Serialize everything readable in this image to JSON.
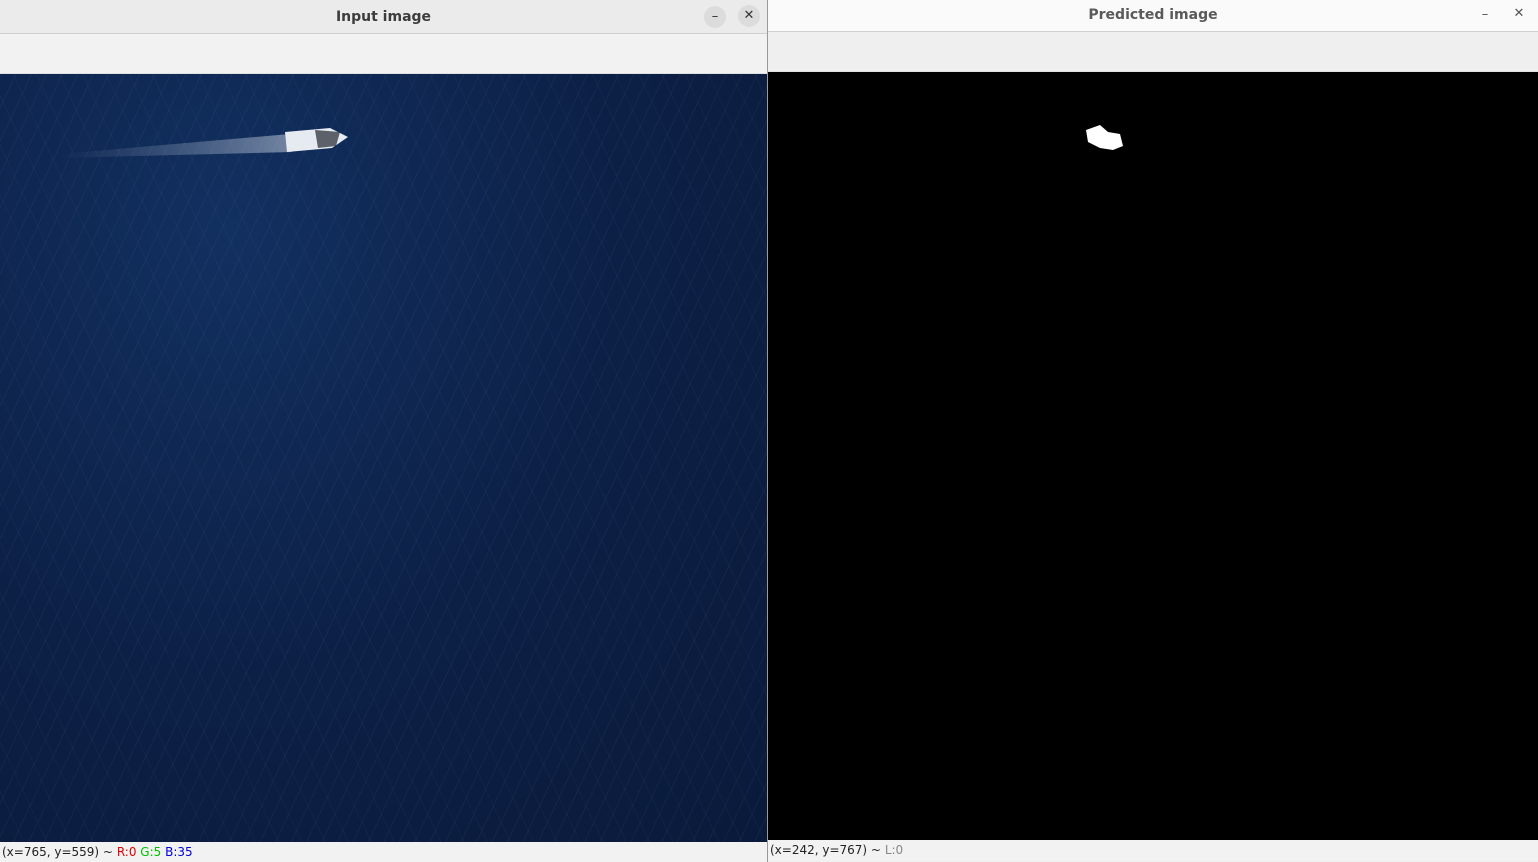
{
  "left_window": {
    "title": "Input image",
    "status": {
      "coords": "(x=765, y=559) ~",
      "r": "R:0",
      "g": "G:5",
      "b": "B:35"
    }
  },
  "right_window": {
    "title": "Predicted image",
    "status": {
      "coords": "(x=242, y=767) ~",
      "l": "L:0"
    }
  },
  "controls": {
    "minimize_glyph": "–",
    "close_glyph": "✕"
  },
  "colors": {
    "sea": "#0c1f44",
    "mask_bg": "#000000",
    "mask_fg": "#ffffff"
  },
  "icons": [
    "minimize-icon",
    "close-icon"
  ]
}
